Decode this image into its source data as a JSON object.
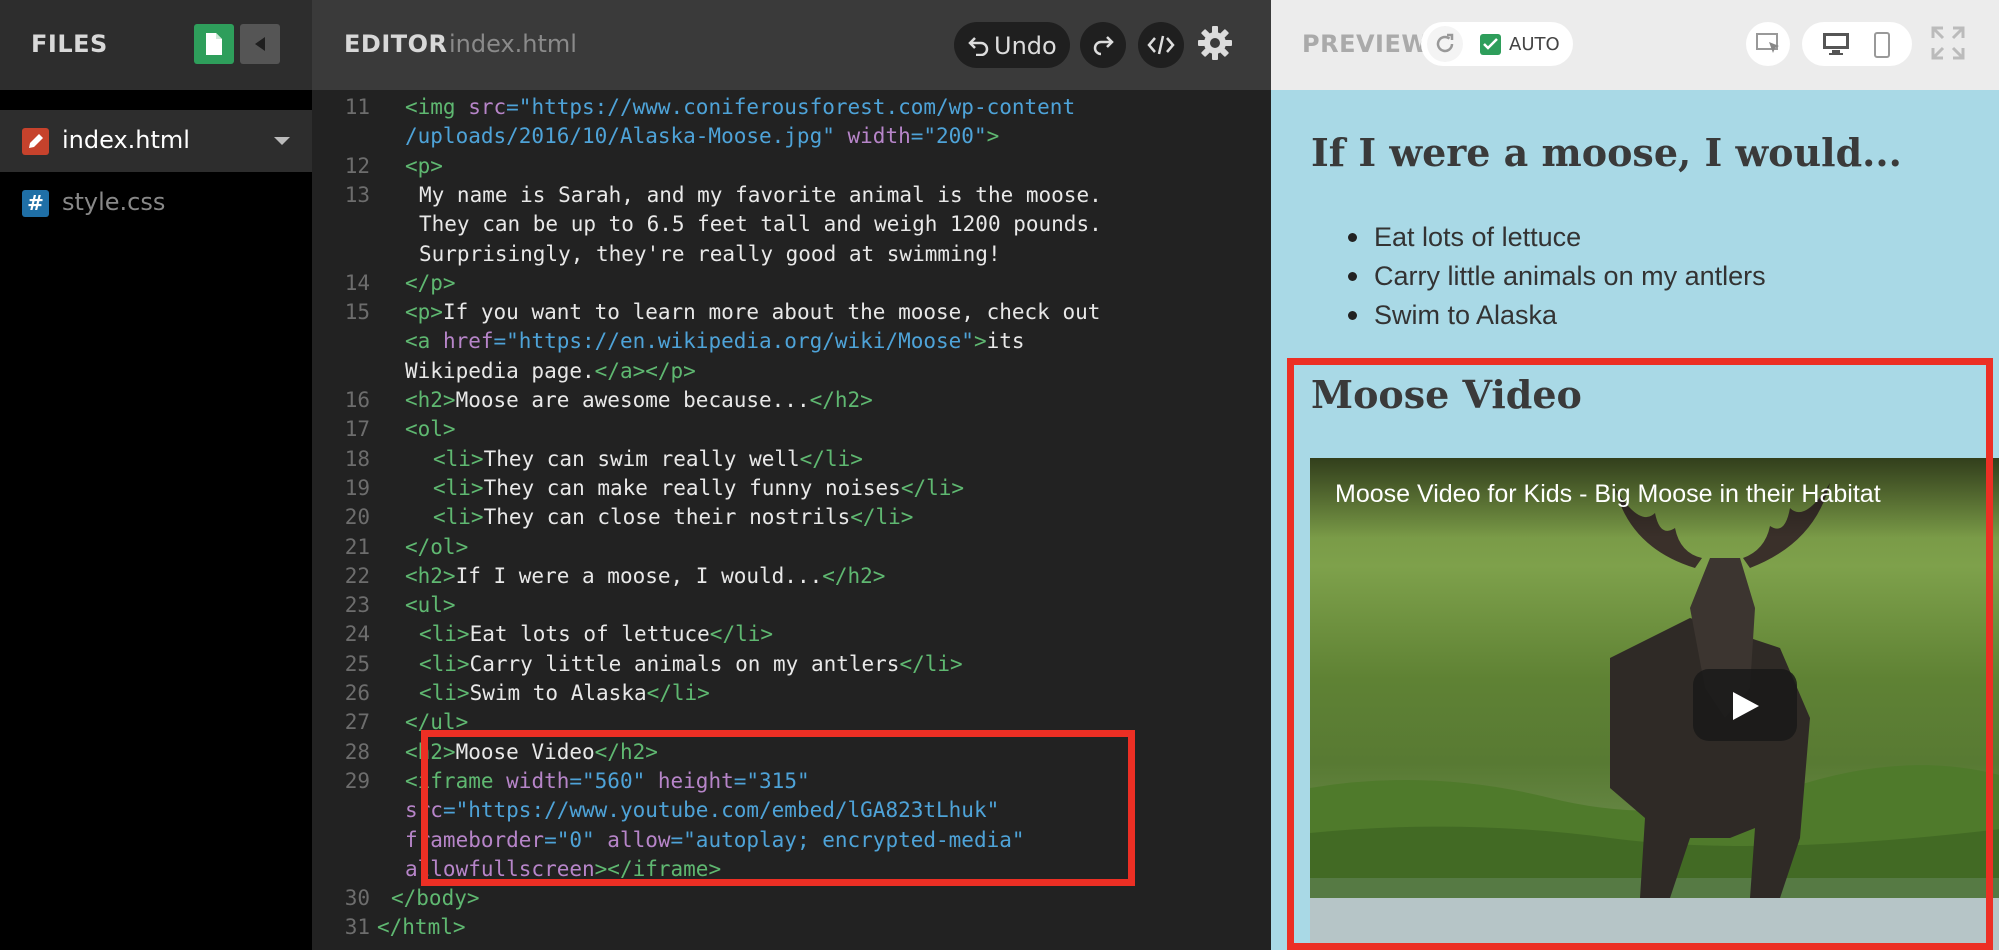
{
  "sidebar": {
    "title": "FILES",
    "files": [
      {
        "name": "index.html",
        "icon": "pencil-icon",
        "active": true
      },
      {
        "name": "style.css",
        "icon": "hash-icon",
        "active": false
      }
    ]
  },
  "editor": {
    "title": "EDITOR",
    "filename": "index.html",
    "undo_label": "Undo",
    "lines": [
      {
        "n": "11",
        "wrap": [
          [
            {
              "t": "<img ",
              "c": "tg"
            },
            {
              "t": "src",
              "c": "at"
            },
            {
              "t": "=\"https://www.coniferousforest.com/wp-content",
              "c": "st"
            }
          ],
          [
            {
              "t": "/uploads/2016/10/Alaska-Moose.jpg\"",
              "c": "st"
            },
            {
              "t": " width",
              "c": "at"
            },
            {
              "t": "=\"200\"",
              "c": "st"
            },
            {
              "t": ">",
              "c": "tg"
            }
          ]
        ],
        "indent": 2
      },
      {
        "n": "12",
        "wrap": [
          [
            {
              "t": "<p>",
              "c": "tg"
            }
          ]
        ],
        "indent": 2
      },
      {
        "n": "13",
        "wrap": [
          [
            {
              "t": "My name is Sarah, and my favorite animal is the moose.",
              "c": ""
            }
          ],
          [
            {
              "t": "They can be up to 6.5 feet tall and weigh 1200 pounds.",
              "c": ""
            }
          ],
          [
            {
              "t": "Surprisingly, they're really good at swimming!",
              "c": ""
            }
          ]
        ],
        "indent": 3
      },
      {
        "n": "14",
        "wrap": [
          [
            {
              "t": "</p>",
              "c": "tg"
            }
          ]
        ],
        "indent": 2
      },
      {
        "n": "15",
        "wrap": [
          [
            {
              "t": "<p>",
              "c": "tg"
            },
            {
              "t": "If you want to learn more about the moose, check out",
              "c": ""
            }
          ],
          [
            {
              "t": "<a ",
              "c": "tg"
            },
            {
              "t": "href",
              "c": "at"
            },
            {
              "t": "=\"https://en.wikipedia.org/wiki/Moose\"",
              "c": "st"
            },
            {
              "t": ">",
              "c": "tg"
            },
            {
              "t": "its",
              "c": ""
            }
          ],
          [
            {
              "t": "Wikipedia page.",
              "c": ""
            },
            {
              "t": "</a></p>",
              "c": "tg"
            }
          ]
        ],
        "indent": 2
      },
      {
        "n": "16",
        "wrap": [
          [
            {
              "t": "<h2>",
              "c": "tg"
            },
            {
              "t": "Moose are awesome because...",
              "c": ""
            },
            {
              "t": "</h2>",
              "c": "tg"
            }
          ]
        ],
        "indent": 2
      },
      {
        "n": "17",
        "wrap": [
          [
            {
              "t": "<ol>",
              "c": "tg"
            }
          ]
        ],
        "indent": 2
      },
      {
        "n": "18",
        "wrap": [
          [
            {
              "t": "<li>",
              "c": "tg"
            },
            {
              "t": "They can swim really well",
              "c": ""
            },
            {
              "t": "</li>",
              "c": "tg"
            }
          ]
        ],
        "indent": 4
      },
      {
        "n": "19",
        "wrap": [
          [
            {
              "t": "<li>",
              "c": "tg"
            },
            {
              "t": "They can make really funny noises",
              "c": ""
            },
            {
              "t": "</li>",
              "c": "tg"
            }
          ]
        ],
        "indent": 4
      },
      {
        "n": "20",
        "wrap": [
          [
            {
              "t": "<li>",
              "c": "tg"
            },
            {
              "t": "They can close their nostrils",
              "c": ""
            },
            {
              "t": "</li>",
              "c": "tg"
            }
          ]
        ],
        "indent": 4
      },
      {
        "n": "21",
        "wrap": [
          [
            {
              "t": "</ol>",
              "c": "tg"
            }
          ]
        ],
        "indent": 2
      },
      {
        "n": "22",
        "wrap": [
          [
            {
              "t": "<h2>",
              "c": "tg"
            },
            {
              "t": "If I were a moose, I would...",
              "c": ""
            },
            {
              "t": "</h2>",
              "c": "tg"
            }
          ]
        ],
        "indent": 2
      },
      {
        "n": "23",
        "wrap": [
          [
            {
              "t": "<ul>",
              "c": "tg"
            }
          ]
        ],
        "indent": 2
      },
      {
        "n": "24",
        "wrap": [
          [
            {
              "t": "<li>",
              "c": "tg"
            },
            {
              "t": "Eat lots of lettuce",
              "c": ""
            },
            {
              "t": "</li>",
              "c": "tg"
            }
          ]
        ],
        "indent": 3
      },
      {
        "n": "25",
        "wrap": [
          [
            {
              "t": "<li>",
              "c": "tg"
            },
            {
              "t": "Carry little animals on my antlers",
              "c": ""
            },
            {
              "t": "</li>",
              "c": "tg"
            }
          ]
        ],
        "indent": 3
      },
      {
        "n": "26",
        "wrap": [
          [
            {
              "t": "<li>",
              "c": "tg"
            },
            {
              "t": "Swim to Alaska",
              "c": ""
            },
            {
              "t": "</li>",
              "c": "tg"
            }
          ]
        ],
        "indent": 3
      },
      {
        "n": "27",
        "wrap": [
          [
            {
              "t": "</ul>",
              "c": "tg"
            }
          ]
        ],
        "indent": 2
      },
      {
        "n": "28",
        "wrap": [
          [
            {
              "t": "<h2>",
              "c": "tg"
            },
            {
              "t": "Moose Video",
              "c": ""
            },
            {
              "t": "</h2>",
              "c": "tg"
            }
          ]
        ],
        "indent": 2
      },
      {
        "n": "29",
        "wrap": [
          [
            {
              "t": "<iframe ",
              "c": "tg"
            },
            {
              "t": "width",
              "c": "at"
            },
            {
              "t": "=\"560\"",
              "c": "st"
            },
            {
              "t": " height",
              "c": "at"
            },
            {
              "t": "=\"315\"",
              "c": "st"
            }
          ],
          [
            {
              "t": "src",
              "c": "at"
            },
            {
              "t": "=\"https://www.youtube.com/embed/lGA823tLhuk\"",
              "c": "st"
            }
          ],
          [
            {
              "t": "frameborder",
              "c": "at"
            },
            {
              "t": "=\"0\"",
              "c": "st"
            },
            {
              "t": " allow",
              "c": "at"
            },
            {
              "t": "=\"autoplay; encrypted-media\"",
              "c": "st"
            }
          ],
          [
            {
              "t": "allowfullscreen",
              "c": "at"
            },
            {
              "t": "></iframe>",
              "c": "tg"
            }
          ]
        ],
        "indent": 2
      },
      {
        "n": "30",
        "wrap": [
          [
            {
              "t": "</body>",
              "c": "tg"
            }
          ]
        ],
        "indent": 1
      },
      {
        "n": "31",
        "wrap": [
          [
            {
              "t": "</html>",
              "c": "tg"
            }
          ]
        ],
        "indent": 0
      }
    ]
  },
  "preview": {
    "title": "PREVIEW",
    "auto_label": "AUTO",
    "auto_checked": true,
    "heading_moose": "If I were a moose, I would...",
    "list": [
      "Eat lots of lettuce",
      "Carry little animals on my antlers",
      "Swim to Alaska"
    ],
    "heading_video": "Moose Video",
    "video_title": "Moose Video for Kids - Big Moose in their Habitat"
  },
  "colors": {
    "accent_green": "#2e9e5b",
    "highlight_red": "#ec2f24",
    "preview_bg": "#a9d9e6"
  }
}
